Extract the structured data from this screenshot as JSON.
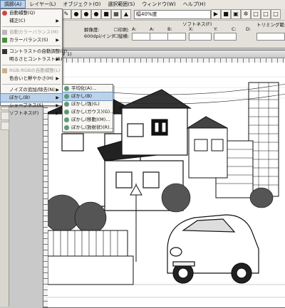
{
  "menubar": {
    "items": [
      {
        "label": "調節(A)"
      },
      {
        "label": "レイヤー(L)"
      },
      {
        "label": "オブジェクト(O)"
      },
      {
        "label": "選択範囲(S)"
      },
      {
        "label": "ウィンドウ(W)"
      },
      {
        "label": "ヘルプ(H)"
      }
    ]
  },
  "toolbar": {
    "width_select": "幅40%度",
    "density_label": "解像度:",
    "density_value": "600dpi/インチ",
    "print_label": "印刷:",
    "label2": "縦横:",
    "softness_label": "ソフトネス(F)",
    "x_label": "X:",
    "y_label": "Y:",
    "right_label": "トリミング範",
    "small_labels": [
      "A:",
      "A:",
      "B:",
      "C:",
      "D:"
    ]
  },
  "adjust_menu": {
    "items": [
      {
        "label": "自動補整(Q)",
        "disabled": false,
        "submenu": false
      },
      {
        "label": "補正(C)",
        "disabled": false,
        "submenu": true
      },
      {
        "label": "自動カラーバランス(M)",
        "disabled": true,
        "submenu": false
      },
      {
        "label": "カラーバランス(S)",
        "disabled": false,
        "submenu": true
      },
      {
        "label": "コントラストの自動調整(U)",
        "disabled": false,
        "submenu": false
      },
      {
        "label": "明るさとコントラスト(B)",
        "disabled": false,
        "submenu": true
      },
      {
        "label": "RGB:RGBの自動補整(L)",
        "disabled": true,
        "submenu": false
      },
      {
        "label": "色合いと鮮やかさ(H)",
        "disabled": false,
        "submenu": true
      },
      {
        "label": "ノイズの追加/除去(N)",
        "disabled": false,
        "submenu": true
      },
      {
        "label": "ぼかし(B)",
        "disabled": false,
        "submenu": true,
        "hover": true
      },
      {
        "label": "シャープネス(S)",
        "disabled": false,
        "submenu": true
      },
      {
        "label": "ソフトネス(F)",
        "disabled": false,
        "submenu": true
      }
    ]
  },
  "blur_submenu": {
    "items": [
      {
        "label": "平均化(A)..."
      },
      {
        "label": "ぼかし(B)",
        "hover": true
      },
      {
        "label": "ぼかし(強)(L)"
      },
      {
        "label": "ぼかし(ガウス)(G)..."
      },
      {
        "label": "ぼかし(移動)(M)..."
      },
      {
        "label": "ぼかし(放射状)(R)..."
      }
    ]
  },
  "document": {
    "title": "a (ラスタ 1)"
  },
  "colors": {
    "menu_highlight": "#bcd2ea",
    "toolbar_bg": "#e3e1da"
  }
}
